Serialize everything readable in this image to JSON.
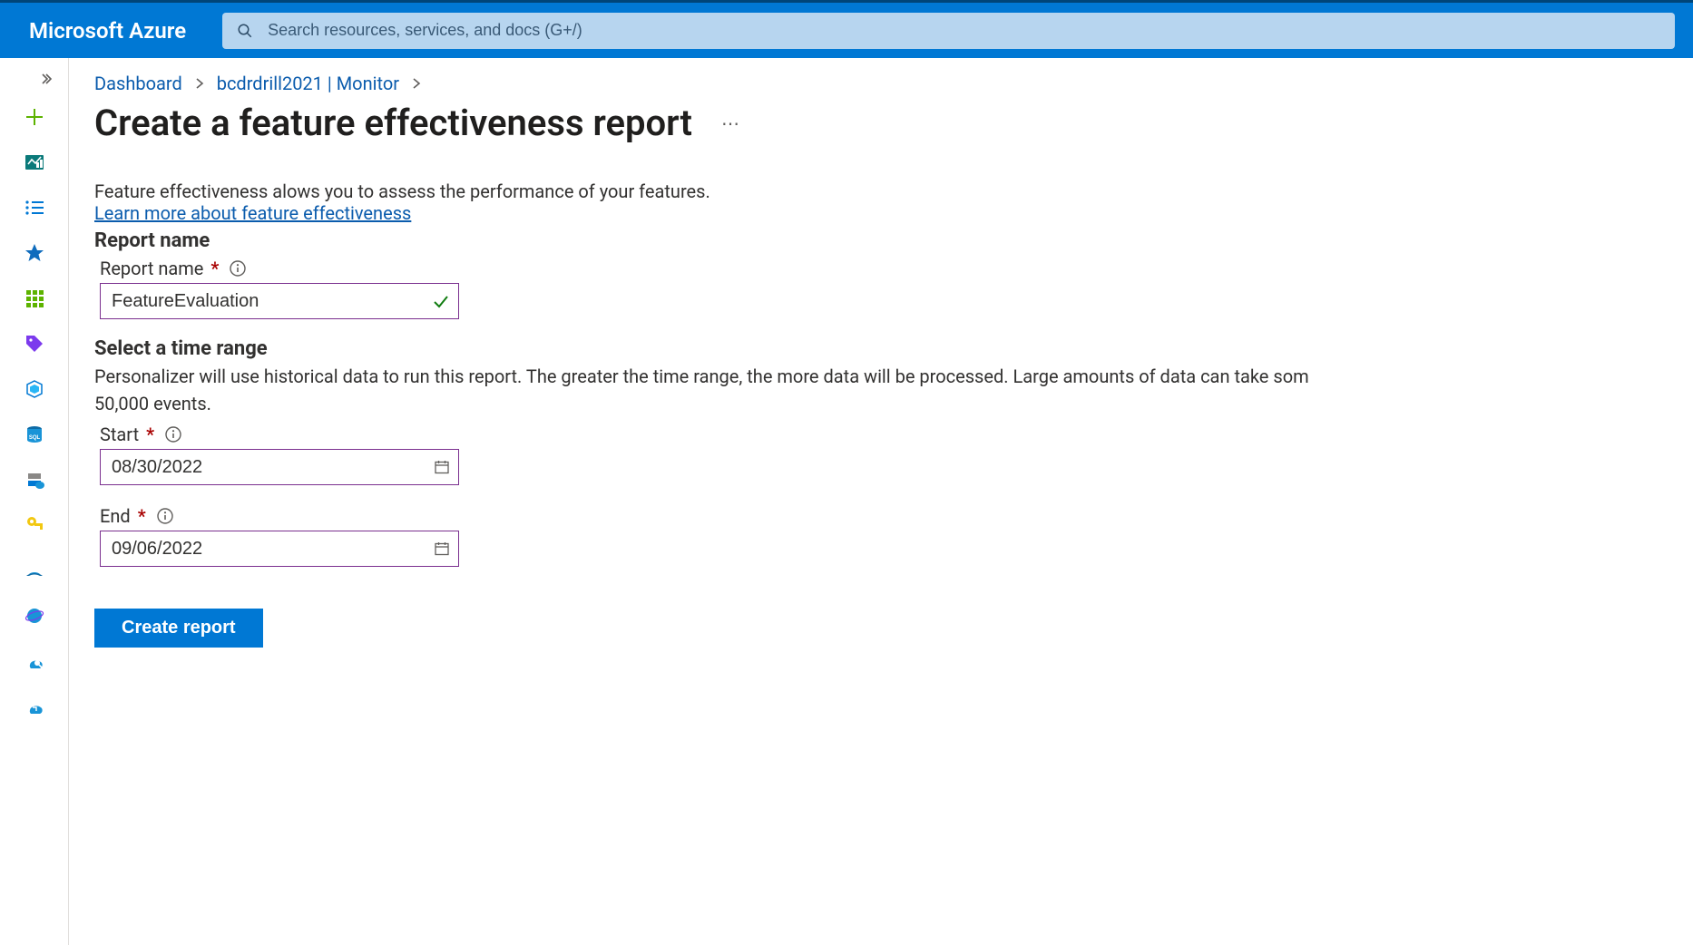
{
  "colors": {
    "azure_blue": "#0078d4",
    "search_bg": "#b7d5ef",
    "link": "#0b5cad",
    "input_border": "#7a2f8f",
    "required": "#a80000",
    "success": "#107c10"
  },
  "header": {
    "brand": "Microsoft Azure",
    "search_placeholder": "Search resources, services, and docs (G+/)"
  },
  "rail": {
    "items": [
      {
        "name": "create-resource-icon"
      },
      {
        "name": "dashboard-icon"
      },
      {
        "name": "all-services-list-icon"
      },
      {
        "name": "favorites-star-icon"
      },
      {
        "name": "all-resources-grid-icon"
      },
      {
        "name": "tags-icon"
      },
      {
        "name": "resource-groups-icon"
      },
      {
        "name": "sql-databases-icon"
      },
      {
        "name": "sql-servers-icon"
      },
      {
        "name": "key-vaults-icon"
      },
      {
        "name": "azure-arc-icon"
      },
      {
        "name": "cosmos-db-icon"
      },
      {
        "name": "azure-monitor-icon"
      },
      {
        "name": "cloud-sync-icon"
      }
    ]
  },
  "breadcrumbs": {
    "items": [
      {
        "label": "Dashboard"
      },
      {
        "label": "bcdrdrill2021 | Monitor"
      }
    ]
  },
  "page": {
    "title": "Create a feature effectiveness report",
    "intro": "Feature effectiveness alows you to assess the performance of your features.",
    "learn_more": "Learn more about feature effectiveness",
    "section_report_name": "Report name",
    "report_name_label": "Report name",
    "report_name_value": "FeatureEvaluation",
    "section_time_range": "Select a time range",
    "time_range_desc_line1": "Personalizer will use historical data to run this report. The greater the time range, the more data will be processed. Large amounts of data can take som",
    "time_range_desc_line2": "50,000 events.",
    "start_label": "Start",
    "start_value": "08/30/2022",
    "end_label": "End",
    "end_value": "09/06/2022",
    "create_button": "Create report"
  }
}
